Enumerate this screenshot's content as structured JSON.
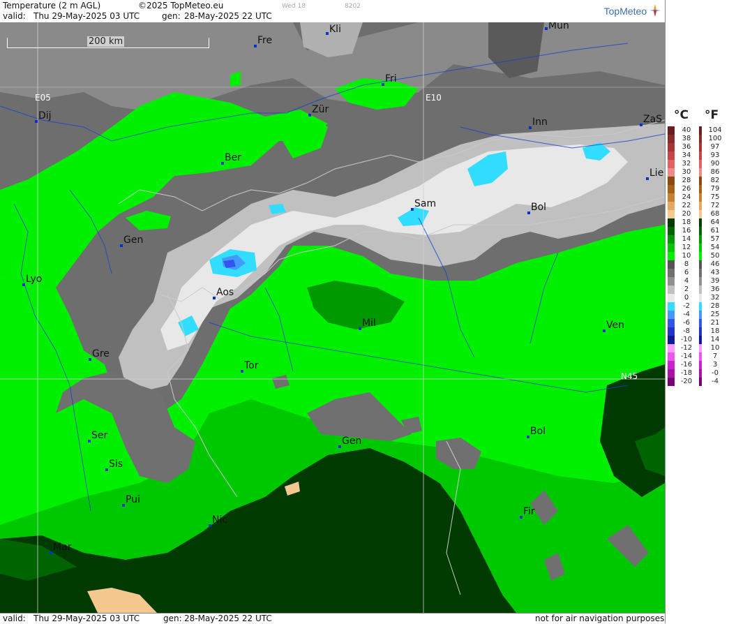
{
  "header": {
    "title": "Temperature (2 m AGL)",
    "copyright": "©2025 TopMeteo.eu",
    "faint_day": "Wed 18",
    "faint_code": "8202",
    "valid_label": "valid:",
    "valid_value": "Thu  29-May-2025  03 UTC",
    "gen_label": "gen:",
    "gen_value": "28-May-2025 22 UTC",
    "logo": "TopMeteo"
  },
  "footer": {
    "valid_label": "valid:",
    "valid_value": "Thu  29-May-2025  03 UTC",
    "gen_label": "gen:",
    "gen_value": "28-May-2025 22 UTC",
    "notice": "not for air navigation purposes"
  },
  "map": {
    "scale_label": "200 km",
    "grid_labels": {
      "e05": "E05",
      "e10": "E10",
      "n45": "N45"
    },
    "cities": [
      {
        "name": "Kli"
      },
      {
        "name": "Mun"
      },
      {
        "name": "Fre"
      },
      {
        "name": "Fri"
      },
      {
        "name": "Dij"
      },
      {
        "name": "Zür"
      },
      {
        "name": "Inn"
      },
      {
        "name": "ZaS"
      },
      {
        "name": "Ber"
      },
      {
        "name": "Lie"
      },
      {
        "name": "Sam"
      },
      {
        "name": "Bol"
      },
      {
        "name": "Gen"
      },
      {
        "name": "Lyo"
      },
      {
        "name": "Aos"
      },
      {
        "name": "Mil"
      },
      {
        "name": "Ven"
      },
      {
        "name": "Gre"
      },
      {
        "name": "Tor"
      },
      {
        "name": "Ser"
      },
      {
        "name": "Gen"
      },
      {
        "name": "Bol"
      },
      {
        "name": "Sis"
      },
      {
        "name": "Pui"
      },
      {
        "name": "Nic"
      },
      {
        "name": "Fir"
      },
      {
        "name": "Mar"
      }
    ]
  },
  "legend": {
    "unit_c": "°C",
    "unit_f": "°F",
    "entries": [
      {
        "c": "40",
        "f": "104",
        "color": "#6b1e1e"
      },
      {
        "c": "38",
        "f": "100",
        "color": "#8b2a2a"
      },
      {
        "c": "36",
        "f": "97",
        "color": "#a83535"
      },
      {
        "c": "34",
        "f": "93",
        "color": "#c74545"
      },
      {
        "c": "32",
        "f": "90",
        "color": "#e06262"
      },
      {
        "c": "30",
        "f": "86",
        "color": "#f08a8a"
      },
      {
        "c": "28",
        "f": "82",
        "color": "#8a4a10"
      },
      {
        "c": "26",
        "f": "79",
        "color": "#a86018"
      },
      {
        "c": "24",
        "f": "75",
        "color": "#c98030"
      },
      {
        "c": "22",
        "f": "72",
        "color": "#e8a860"
      },
      {
        "c": "20",
        "f": "68",
        "color": "#f5c88f"
      },
      {
        "c": "18",
        "f": "64",
        "color": "#003a00"
      },
      {
        "c": "16",
        "f": "61",
        "color": "#006400"
      },
      {
        "c": "14",
        "f": "57",
        "color": "#009a00"
      },
      {
        "c": "12",
        "f": "54",
        "color": "#00c800"
      },
      {
        "c": "10",
        "f": "50",
        "color": "#00f000"
      },
      {
        "c": "8",
        "f": "46",
        "color": "#555555"
      },
      {
        "c": "6",
        "f": "43",
        "color": "#707070"
      },
      {
        "c": "4",
        "f": "39",
        "color": "#909090"
      },
      {
        "c": "2",
        "f": "36",
        "color": "#c0c0c0"
      },
      {
        "c": "0",
        "f": "32",
        "color": "#e8e8e8"
      },
      {
        "c": "-2",
        "f": "28",
        "color": "#33ddff"
      },
      {
        "c": "-4",
        "f": "25",
        "color": "#4499ff"
      },
      {
        "c": "-6",
        "f": "21",
        "color": "#3355ee"
      },
      {
        "c": "-8",
        "f": "18",
        "color": "#2233cc"
      },
      {
        "c": "-10",
        "f": "14",
        "color": "#0a1a99"
      },
      {
        "c": "-12",
        "f": "10",
        "color": "#ff99ff"
      },
      {
        "c": "-14",
        "f": "7",
        "color": "#ee55ee"
      },
      {
        "c": "-16",
        "f": "3",
        "color": "#cc22cc"
      },
      {
        "c": "-18",
        "f": "-0",
        "color": "#aa11aa"
      },
      {
        "c": "-20",
        "f": "-4",
        "color": "#770077"
      }
    ]
  }
}
